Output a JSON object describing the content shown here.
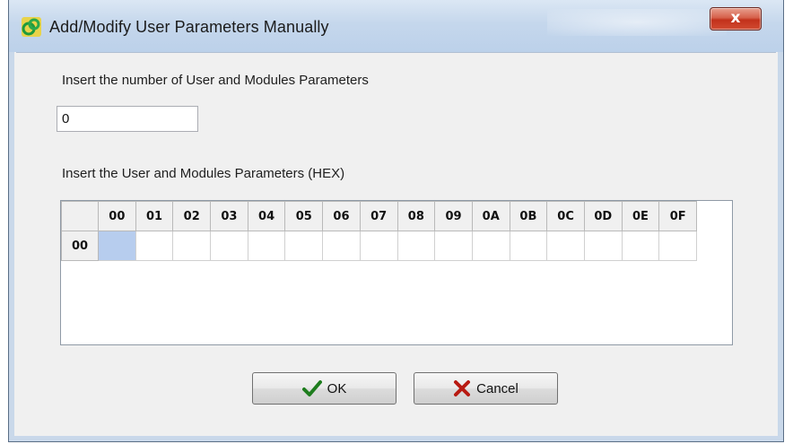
{
  "window": {
    "title": "Add/Modify User Parameters Manually",
    "close_label": "x"
  },
  "form": {
    "count_label": "Insert the number of User and Modules Parameters",
    "count_value": "0",
    "params_label": "Insert the User and Modules Parameters (HEX)"
  },
  "grid": {
    "columns": [
      "00",
      "01",
      "02",
      "03",
      "04",
      "05",
      "06",
      "07",
      "08",
      "09",
      "0A",
      "0B",
      "0C",
      "0D",
      "0E",
      "0F"
    ],
    "rows": [
      "00"
    ]
  },
  "buttons": {
    "ok_label": "OK",
    "cancel_label": "Cancel"
  },
  "colors": {
    "titlebar": "#c5d7ec",
    "selected_cell": "#b7cdee",
    "close_button": "#c2311b"
  },
  "icons": {
    "app": "app-logo-icon",
    "ok": "checkmark-icon",
    "cancel": "red-x-icon"
  }
}
